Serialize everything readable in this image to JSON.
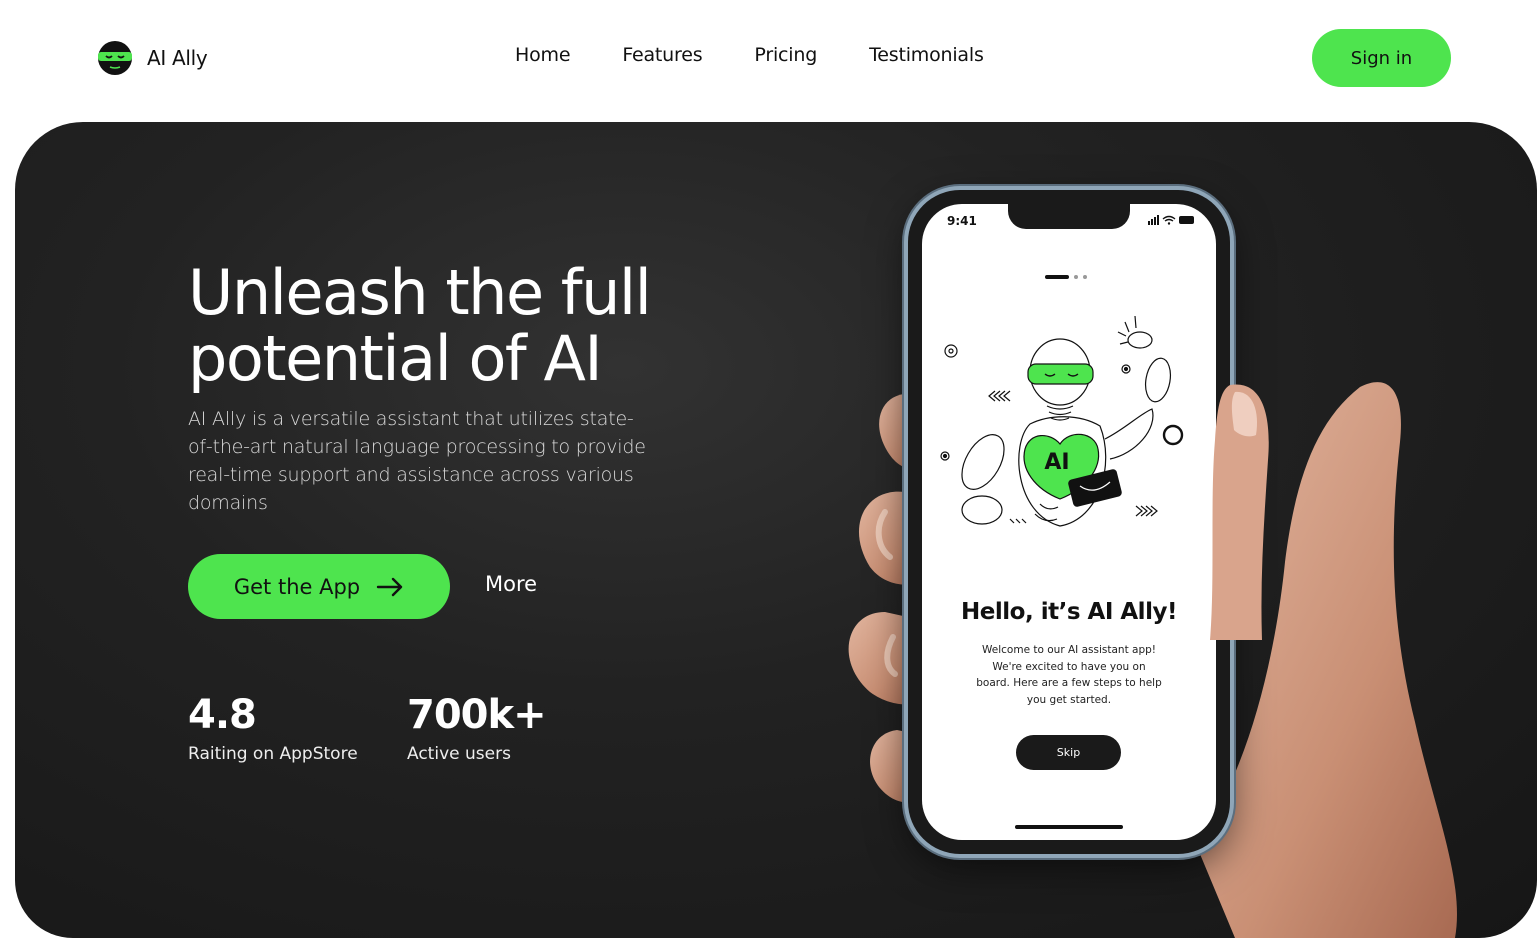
{
  "brand": {
    "name": "AI Ally",
    "logo_icon": "ninja-mask-logo-icon"
  },
  "nav": {
    "items": [
      "Home",
      "Features",
      "Pricing",
      "Testimonials"
    ]
  },
  "signin_label": "Sign in",
  "hero": {
    "headline": "Unleash the full potential of AI",
    "description": "AI Ally is a versatile assistant that utilizes state-of-the-art natural language processing to provide real-time support and assistance across various domains",
    "cta_label": "Get the App",
    "cta_icon": "arrow-right-icon",
    "more_label": "More",
    "stats": [
      {
        "value": "4.8",
        "label": "Raiting on AppStore"
      },
      {
        "value": "700k+",
        "label": "Active users"
      }
    ]
  },
  "phone": {
    "time": "9:41",
    "robot_badge": "AI",
    "title": "Hello, it’s AI Ally!",
    "body": "Welcome to our AI assistant app! We're excited to have you on board. Here are a few steps to help you get started.",
    "skip_label": "Skip"
  },
  "colors": {
    "accent": "#4ee44e",
    "hero_bg": "#1c1c1c",
    "text_dark": "#111111"
  }
}
